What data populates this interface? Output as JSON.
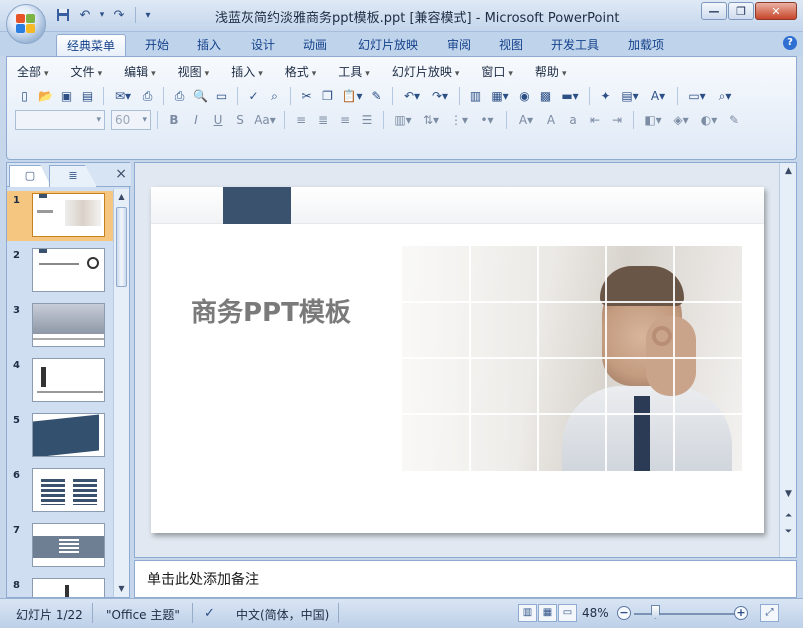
{
  "window": {
    "title": "浅蓝灰简约淡雅商务ppt模板.ppt [兼容模式] - Microsoft PowerPoint",
    "minimize": "—",
    "restore": "❐",
    "close": "✕"
  },
  "quick_access": {
    "save_icon": "save-icon",
    "undo": "↶",
    "redo": "↷",
    "customize": "▾"
  },
  "ribbon_tabs": [
    "经典菜单",
    "开始",
    "插入",
    "设计",
    "动画",
    "幻灯片放映",
    "审阅",
    "视图",
    "开发工具",
    "加载项"
  ],
  "active_tab": "经典菜单",
  "help": "?",
  "classic_menu": [
    "全部",
    "文件",
    "编辑",
    "视图",
    "插入",
    "格式",
    "工具",
    "幻灯片放映",
    "窗口",
    "帮助"
  ],
  "font": {
    "name": "",
    "size": "60"
  },
  "left_panel": {
    "close": "×",
    "slides": [
      "1",
      "2",
      "3",
      "4",
      "5",
      "6",
      "7",
      "8"
    ],
    "selected": "1"
  },
  "slide": {
    "title": "商务PPT模板"
  },
  "notes": {
    "placeholder": "单击此处添加备注"
  },
  "statusbar": {
    "slide_info": "幻灯片 1/22",
    "theme": "\"Office 主题\"",
    "language": "中文(简体，中国)",
    "zoom": "48%",
    "zoom_minus": "−",
    "zoom_plus": "+"
  },
  "colors": {
    "accent": "#3a526e",
    "selection": "#f5c67f",
    "ribbon_border": "#8fabd1"
  }
}
